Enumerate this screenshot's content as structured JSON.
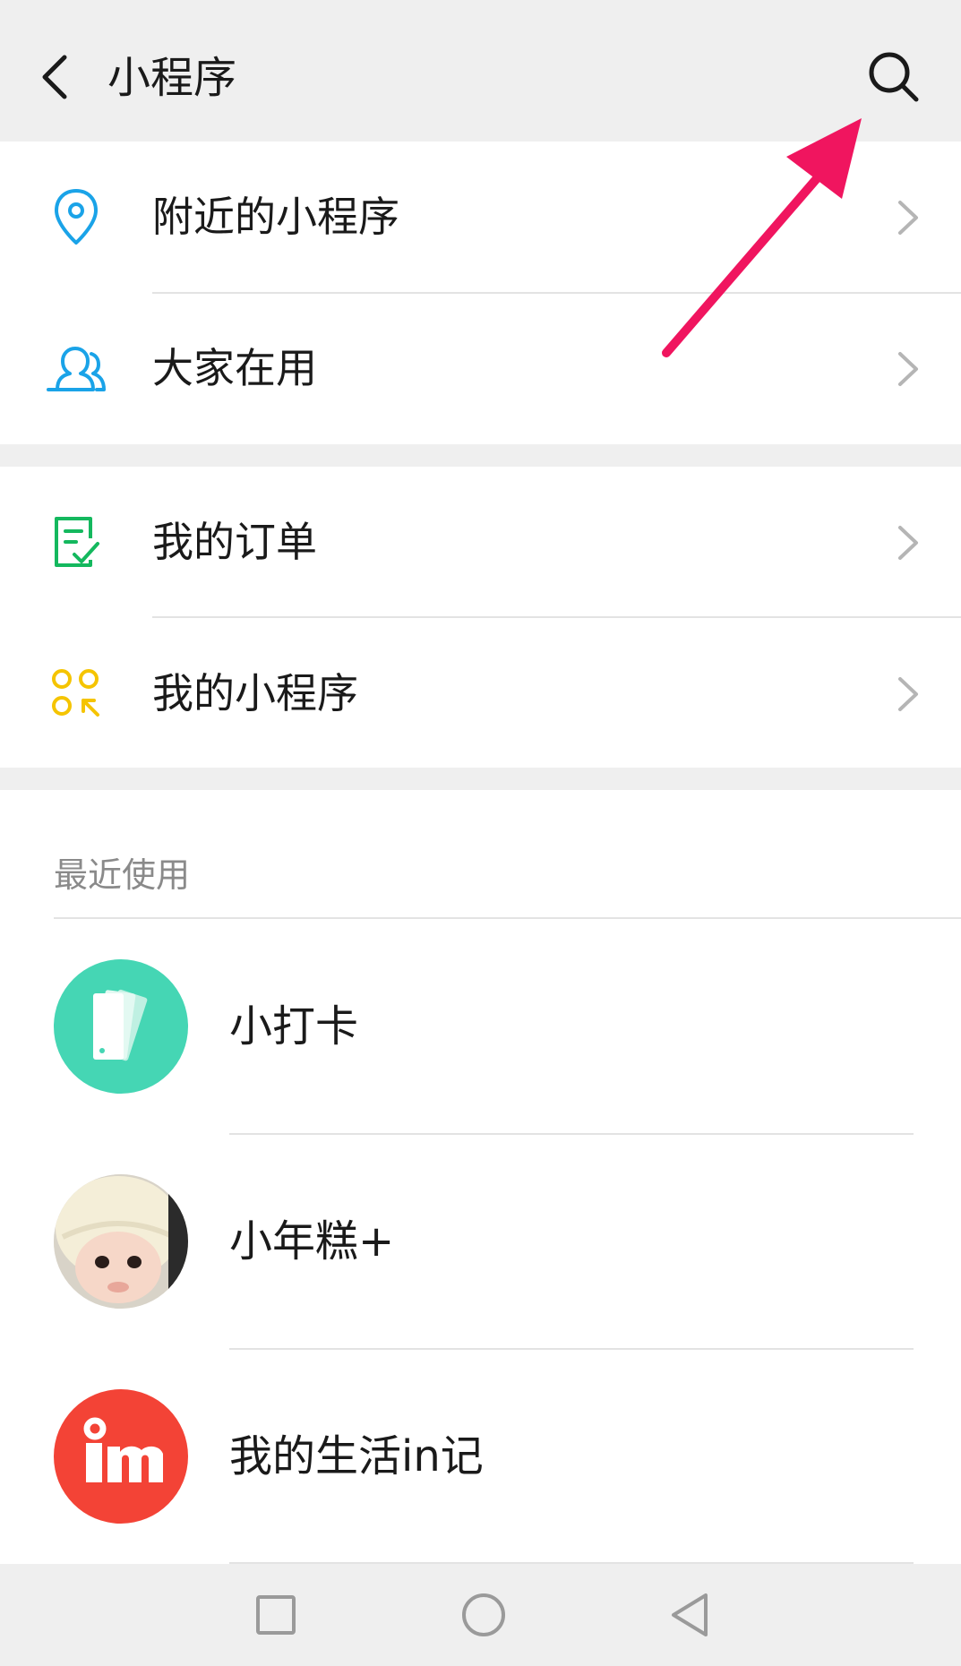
{
  "header": {
    "title": "小程序",
    "back_icon": "chevron-left-icon",
    "search_icon": "search-icon"
  },
  "menu": {
    "group1": [
      {
        "label": "附近的小程序",
        "icon": "location-pin-icon",
        "icon_color": "#1aa3e8"
      },
      {
        "label": "大家在用",
        "icon": "people-icon",
        "icon_color": "#1aa3e8"
      }
    ],
    "group2": [
      {
        "label": "我的订单",
        "icon": "order-checklist-icon",
        "icon_color": "#14b85e"
      },
      {
        "label": "我的小程序",
        "icon": "mini-program-grid-icon",
        "icon_color": "#f5c400"
      }
    ]
  },
  "recent": {
    "title": "最近使用",
    "items": [
      {
        "label": "小打卡",
        "icon": "punch-card-app-icon",
        "color": "#45d6b4"
      },
      {
        "label": "小年糕+",
        "icon": "baby-photo-app-icon",
        "color": "#f3ecd6"
      },
      {
        "label": "我的生活in记",
        "icon": "in-logo-app-icon",
        "color": "#f34336"
      }
    ]
  },
  "navbar": {
    "square_icon": "recent-apps-square-icon",
    "circle_icon": "home-circle-icon",
    "triangle_icon": "back-triangle-icon"
  },
  "annotation": {
    "color": "#f0155f"
  }
}
